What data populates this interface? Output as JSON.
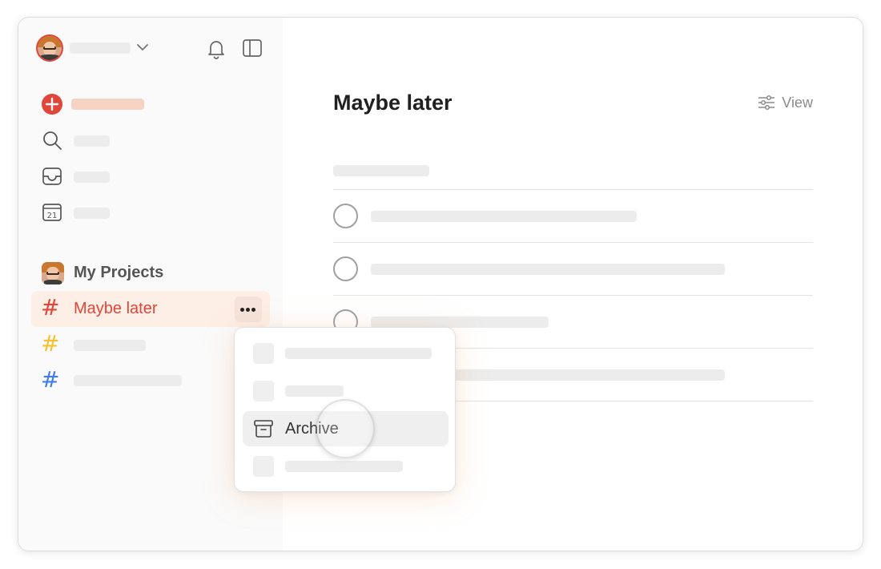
{
  "project": {
    "title": "Maybe later",
    "view_label": "View"
  },
  "sidebar": {
    "my_projects_label": "My Projects",
    "active_project_label": "Maybe later",
    "project_hash_colors": [
      "#e0463a",
      "#f6c12c",
      "#3f7cf0"
    ]
  },
  "context_menu": {
    "archive_label": "Archive"
  },
  "icons": {
    "notifications": "bell-icon",
    "sidebar_toggle": "sidebar-toggle-icon",
    "add_task": "plus-circle-icon",
    "search": "search-icon",
    "inbox": "inbox-icon",
    "today": "calendar-icon",
    "calendar_day": "21",
    "view": "sliders-icon",
    "archive": "archive-box-icon"
  },
  "colors": {
    "accent": "#e0463a",
    "active_row_bg": "#fdeee6"
  }
}
